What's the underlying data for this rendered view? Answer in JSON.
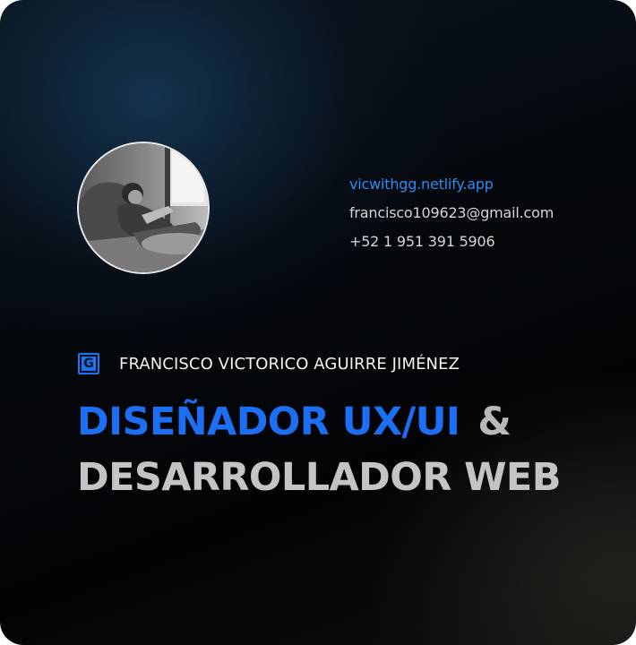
{
  "profile": {
    "name": "FRANCISCO VICTORICO AGUIRRE JIMÉNEZ",
    "logo_letter": "G",
    "avatar_icon": "profile-photo"
  },
  "contact": {
    "website": "vicwithgg.netlify.app",
    "email": "francisco109623@gmail.com",
    "phone": "+52 1 951 391 5906"
  },
  "headline": {
    "role_primary": "DISEÑADOR UX/UI",
    "ampersand": "&",
    "role_secondary": "DESARROLLADOR WEB"
  },
  "colors": {
    "accent": "#1c6ff2",
    "link": "#2f8bf0",
    "secondary_text": "#c4c4c4",
    "background": "#05080c"
  }
}
